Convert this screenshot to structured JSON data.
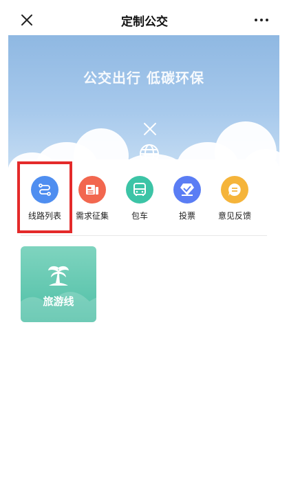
{
  "header": {
    "title": "定制公交"
  },
  "banner": {
    "slogan": "公交出行 低碳环保"
  },
  "menu": {
    "items": [
      {
        "label": "线路列表",
        "icon": "route-icon",
        "color": "#4f8ef0"
      },
      {
        "label": "需求征集",
        "icon": "newspaper-icon",
        "color": "#f2674f"
      },
      {
        "label": "包车",
        "icon": "bus-icon",
        "color": "#3cc4a6"
      },
      {
        "label": "投票",
        "icon": "vote-icon",
        "color": "#5a7df4"
      },
      {
        "label": "意见反馈",
        "icon": "feedback-icon",
        "color": "#f5b43a"
      }
    ]
  },
  "cards": [
    {
      "label": "旅游线",
      "icon": "palm-tree-icon",
      "color": "#5ec5ad"
    }
  ],
  "highlight": {
    "target": "线路列表",
    "color": "#e42a2a"
  }
}
